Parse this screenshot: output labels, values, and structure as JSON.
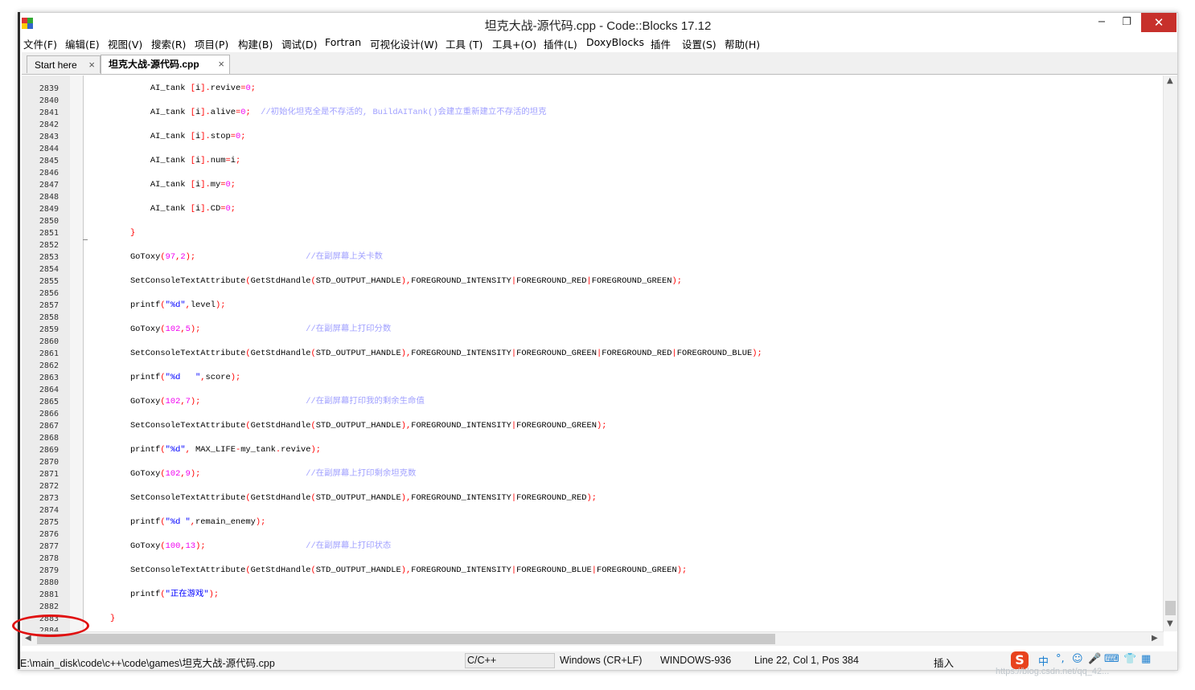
{
  "window": {
    "title": "坦克大战-源代码.cpp - Code::Blocks 17.12",
    "minimize": "−",
    "maximize": "❐",
    "close": "✕"
  },
  "menu": [
    "文件(F)",
    "编辑(E)",
    "视图(V)",
    "搜索(R)",
    "项目(P)",
    "构建(B)",
    "调试(D)",
    "Fortran",
    "可视化设计(W)",
    "工具 (T)",
    "工具+(O)",
    "插件(L)",
    "DoxyBlocks",
    "插件",
    "设置(S)",
    "帮助(H)"
  ],
  "tabs": [
    {
      "label": "Start here",
      "active": false
    },
    {
      "label": "坦克大战-源代码.cpp",
      "active": true
    }
  ],
  "tab_close_glyph": "×",
  "editor": {
    "colors": {
      "number": "#f000f0",
      "string": "#0000ff",
      "comment": "#a0a0ff",
      "operator": "#ff0000",
      "identifier": "#000000"
    },
    "lines": [
      {
        "n": "2839",
        "code": "        AI_tank [i].revive=0;"
      },
      {
        "n": "2840",
        "code": ""
      },
      {
        "n": "2841",
        "code": "        AI_tank [i].alive=0;  //初始化坦克全是不存活的, BuildAITank()会建立重新建立不存活的坦克"
      },
      {
        "n": "2842",
        "code": ""
      },
      {
        "n": "2843",
        "code": "        AI_tank [i].stop=0;"
      },
      {
        "n": "2844",
        "code": ""
      },
      {
        "n": "2845",
        "code": "        AI_tank [i].num=i;"
      },
      {
        "n": "2846",
        "code": ""
      },
      {
        "n": "2847",
        "code": "        AI_tank [i].my=0;"
      },
      {
        "n": "2848",
        "code": ""
      },
      {
        "n": "2849",
        "code": "        AI_tank [i].CD=0;"
      },
      {
        "n": "2850",
        "code": ""
      },
      {
        "n": "2851",
        "code": "    }"
      },
      {
        "n": "2852",
        "code": ""
      },
      {
        "n": "2853",
        "code": "    GoToxy(97,2);                      //在副屏幕上关卡数"
      },
      {
        "n": "2854",
        "code": ""
      },
      {
        "n": "2855",
        "code": "    SetConsoleTextAttribute(GetStdHandle(STD_OUTPUT_HANDLE),FOREGROUND_INTENSITY|FOREGROUND_RED|FOREGROUND_GREEN);"
      },
      {
        "n": "2856",
        "code": ""
      },
      {
        "n": "2857",
        "code": "    printf(\"%d\",level);"
      },
      {
        "n": "2858",
        "code": ""
      },
      {
        "n": "2859",
        "code": "    GoToxy(102,5);                     //在副屏幕上打印分数"
      },
      {
        "n": "2860",
        "code": ""
      },
      {
        "n": "2861",
        "code": "    SetConsoleTextAttribute(GetStdHandle(STD_OUTPUT_HANDLE),FOREGROUND_INTENSITY|FOREGROUND_GREEN|FOREGROUND_RED|FOREGROUND_BLUE);"
      },
      {
        "n": "2862",
        "code": ""
      },
      {
        "n": "2863",
        "code": "    printf(\"%d   \",score);"
      },
      {
        "n": "2864",
        "code": ""
      },
      {
        "n": "2865",
        "code": "    GoToxy(102,7);                     //在副屏幕打印我的剩余生命值"
      },
      {
        "n": "2866",
        "code": ""
      },
      {
        "n": "2867",
        "code": "    SetConsoleTextAttribute(GetStdHandle(STD_OUTPUT_HANDLE),FOREGROUND_INTENSITY|FOREGROUND_GREEN);"
      },
      {
        "n": "2868",
        "code": ""
      },
      {
        "n": "2869",
        "code": "    printf(\"%d\", MAX_LIFE-my_tank.revive);"
      },
      {
        "n": "2870",
        "code": ""
      },
      {
        "n": "2871",
        "code": "    GoToxy(102,9);                     //在副屏幕上打印剩余坦克数"
      },
      {
        "n": "2872",
        "code": ""
      },
      {
        "n": "2873",
        "code": "    SetConsoleTextAttribute(GetStdHandle(STD_OUTPUT_HANDLE),FOREGROUND_INTENSITY|FOREGROUND_RED);"
      },
      {
        "n": "2874",
        "code": ""
      },
      {
        "n": "2875",
        "code": "    printf(\"%d \",remain_enemy);"
      },
      {
        "n": "2876",
        "code": ""
      },
      {
        "n": "2877",
        "code": "    GoToxy(100,13);                    //在副屏幕上打印状态"
      },
      {
        "n": "2878",
        "code": ""
      },
      {
        "n": "2879",
        "code": "    SetConsoleTextAttribute(GetStdHandle(STD_OUTPUT_HANDLE),FOREGROUND_INTENSITY|FOREGROUND_BLUE|FOREGROUND_GREEN);"
      },
      {
        "n": "2880",
        "code": ""
      },
      {
        "n": "2881",
        "code": "    printf(\"正在游戏\");"
      },
      {
        "n": "2882",
        "code": ""
      },
      {
        "n": "2883",
        "code": "}"
      },
      {
        "n": "2884",
        "code": ""
      }
    ]
  },
  "status": {
    "path": "E:\\main_disk\\code\\c++\\code\\games\\坦克大战-源代码.cpp",
    "language": "C/C++",
    "eol": "Windows (CR+LF)",
    "encoding": "WINDOWS-936",
    "position": "Line 22, Col 1, Pos 384",
    "mode": "插入"
  },
  "ime": {
    "logo": "S",
    "items": [
      "中",
      "°,",
      "☺",
      "🎤",
      "⌨",
      "👕",
      "▦"
    ]
  },
  "watermark": "https://blog.csdn.net/qq_42..."
}
